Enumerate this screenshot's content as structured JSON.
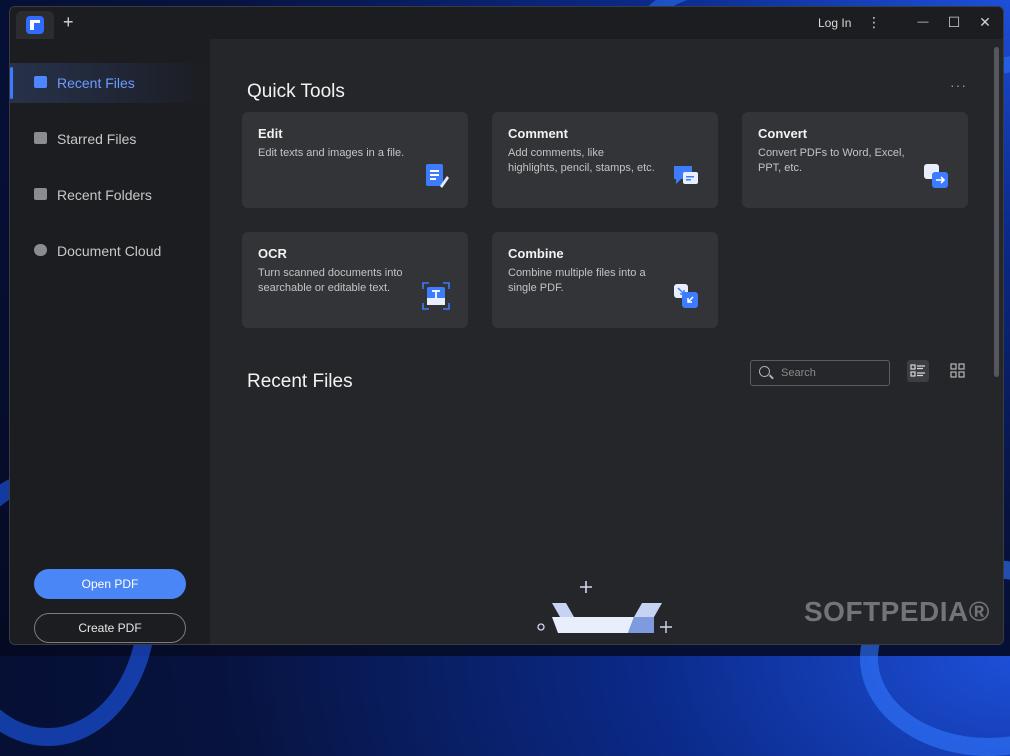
{
  "titlebar": {
    "new_tab": "+",
    "login": "Log In",
    "menu": "⋮",
    "minimize": "—",
    "maximize": "☐",
    "close": "✕"
  },
  "sidebar": {
    "items": [
      {
        "label": "Recent Files",
        "icon": "file-icon",
        "active": true
      },
      {
        "label": "Starred Files",
        "icon": "star-icon",
        "active": false
      },
      {
        "label": "Recent Folders",
        "icon": "folder-icon",
        "active": false
      },
      {
        "label": "Document Cloud",
        "icon": "cloud-icon",
        "active": false
      }
    ],
    "open_pdf": "Open PDF",
    "create_pdf": "Create PDF"
  },
  "quick_tools": {
    "title": "Quick Tools",
    "more": "···",
    "cards": [
      {
        "title": "Edit",
        "desc": "Edit texts and images in a file.",
        "icon": "edit-doc-icon"
      },
      {
        "title": "Comment",
        "desc": "Add comments, like highlights, pencil, stamps, etc.",
        "icon": "comment-icon"
      },
      {
        "title": "Convert",
        "desc": "Convert PDFs to Word, Excel, PPT, etc.",
        "icon": "convert-icon"
      },
      {
        "title": "OCR",
        "desc": "Turn scanned documents into searchable or editable text.",
        "icon": "ocr-icon"
      },
      {
        "title": "Combine",
        "desc": "Combine multiple files into a single PDF.",
        "icon": "combine-icon"
      }
    ]
  },
  "recent_files": {
    "title": "Recent Files",
    "search_placeholder": "Search",
    "view_list": "list-view-icon",
    "view_grid": "grid-view-icon"
  },
  "watermark": "SOFTPEDIA®",
  "colors": {
    "accent": "#4a86f5",
    "active_nav": "#6c9bff",
    "background": "#252629",
    "sidebar": "#1c1d20",
    "card": "#333438"
  }
}
